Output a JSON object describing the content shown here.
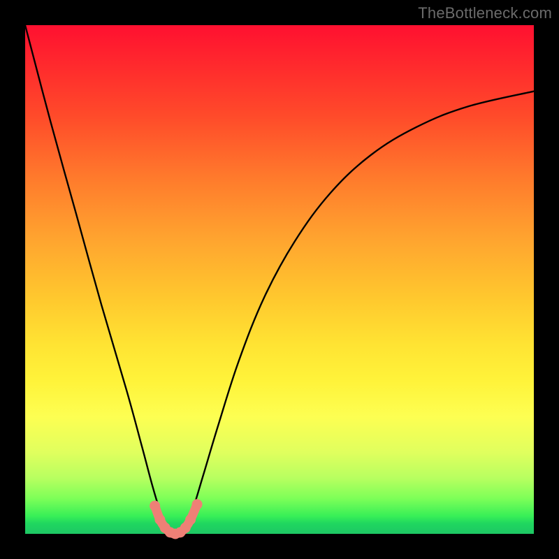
{
  "watermark": "TheBottleneck.com",
  "chart_data": {
    "type": "line",
    "title": "",
    "xlabel": "",
    "ylabel": "",
    "xlim": [
      0,
      1
    ],
    "ylim": [
      0,
      1
    ],
    "series": [
      {
        "name": "bottleneck-curve",
        "x": [
          0.0,
          0.05,
          0.1,
          0.15,
          0.2,
          0.23,
          0.25,
          0.265,
          0.275,
          0.285,
          0.295,
          0.305,
          0.315,
          0.33,
          0.35,
          0.38,
          0.42,
          0.47,
          0.53,
          0.6,
          0.68,
          0.77,
          0.87,
          1.0
        ],
        "values": [
          1.0,
          0.81,
          0.63,
          0.45,
          0.28,
          0.17,
          0.095,
          0.045,
          0.018,
          0.004,
          0.0,
          0.004,
          0.018,
          0.05,
          0.115,
          0.215,
          0.34,
          0.465,
          0.575,
          0.67,
          0.745,
          0.8,
          0.84,
          0.87
        ]
      },
      {
        "name": "optimal-marker",
        "x": [
          0.255,
          0.265,
          0.275,
          0.285,
          0.295,
          0.305,
          0.315,
          0.325,
          0.338
        ],
        "values": [
          0.055,
          0.028,
          0.012,
          0.003,
          0.0,
          0.003,
          0.012,
          0.028,
          0.058
        ]
      }
    ],
    "colors": {
      "curve": "#000000",
      "marker": "#ee8076"
    }
  }
}
